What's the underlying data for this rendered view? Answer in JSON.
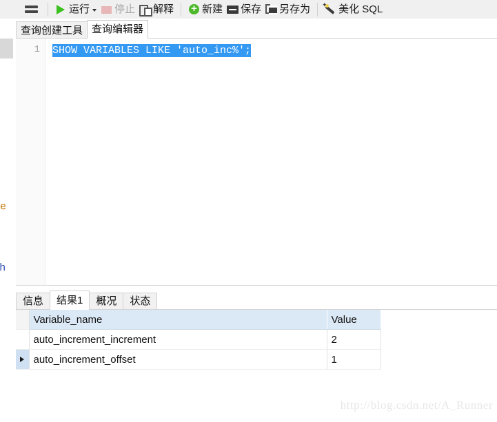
{
  "toolbar": {
    "menu_icon": "hamburger-icon",
    "buttons": [
      {
        "label": "运行",
        "icon": "play-icon",
        "disabled": false,
        "has_caret": true
      },
      {
        "label": "停止",
        "icon": "stop-icon",
        "disabled": true,
        "has_caret": false
      },
      {
        "label": "解释",
        "icon": "explain-icon",
        "disabled": false,
        "has_caret": false
      },
      {
        "label": "新建",
        "icon": "plus-circle-icon",
        "disabled": false,
        "has_caret": false
      },
      {
        "label": "保存",
        "icon": "save-disk-icon",
        "disabled": false,
        "has_caret": false
      },
      {
        "label": "另存为",
        "icon": "save-as-icon",
        "disabled": false,
        "has_caret": false
      },
      {
        "label": "美化 SQL",
        "icon": "magic-wand-icon",
        "disabled": false,
        "has_caret": false
      }
    ]
  },
  "tabs": {
    "items": [
      {
        "label": "查询创建工具",
        "active": false
      },
      {
        "label": "查询编辑器",
        "active": true
      }
    ]
  },
  "editor": {
    "line_number": "1",
    "code": "SHOW VARIABLES LIKE 'auto_inc%';",
    "selection_color": "#3399f3"
  },
  "left_sliver": {
    "fragment_one": "ne",
    "fragment_two": "ch"
  },
  "results": {
    "tabs": [
      {
        "label": "信息",
        "active": false
      },
      {
        "label": "结果1",
        "active": true
      },
      {
        "label": "概况",
        "active": false
      },
      {
        "label": "状态",
        "active": false
      }
    ],
    "grid": {
      "columns": [
        "Variable_name",
        "Value"
      ],
      "rows": [
        {
          "variable_name": "auto_increment_increment",
          "value": "2",
          "selected": false
        },
        {
          "variable_name": "auto_increment_offset",
          "value": "1",
          "selected": true
        }
      ],
      "header_background": "#dbe8f5",
      "selected_row_marker": "▶"
    }
  },
  "watermark": "http://blog.csdn.net/A_Runner"
}
